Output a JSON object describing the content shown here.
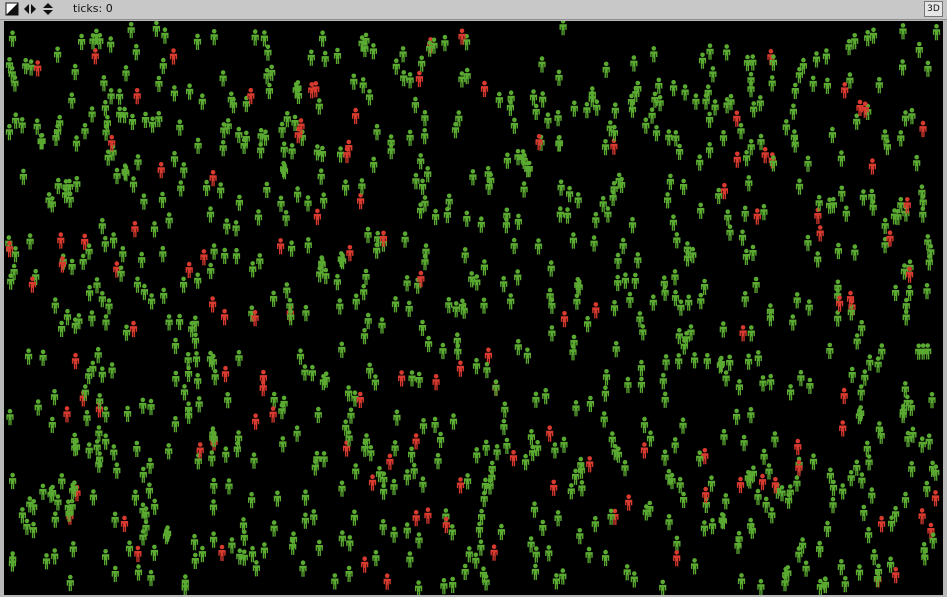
{
  "toolbar": {
    "ticks_label": "ticks:",
    "ticks_value": "0",
    "view3d_label": "3D",
    "icons": [
      "resize-corner-icon",
      "horizontal-arrows-icon",
      "vertical-arrows-icon"
    ]
  },
  "world": {
    "background_color": "#000000",
    "colors": {
      "healthy": "#5aaa32",
      "infected": "#d93a2f"
    },
    "agent_icon": "person-icon",
    "counts": {
      "healthy": 880,
      "infected": 120
    }
  }
}
